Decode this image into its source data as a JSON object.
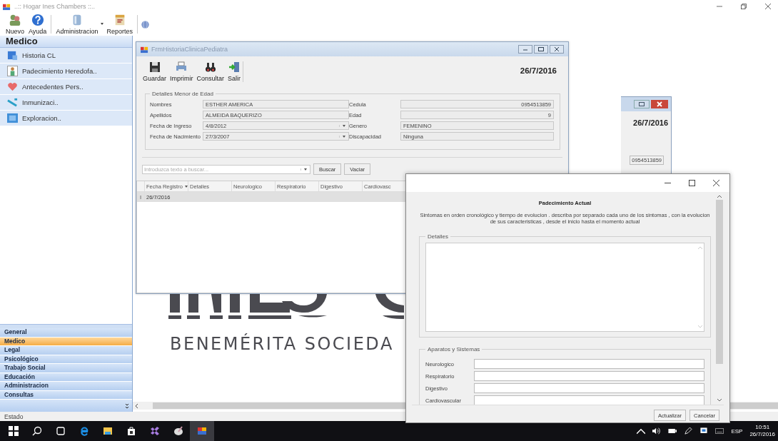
{
  "app": {
    "title": "..:: Hogar Ines Chambers ::.."
  },
  "toolbar": [
    {
      "label": "Nuevo",
      "kind": "people"
    },
    {
      "label": "Ayuda",
      "kind": "help"
    },
    {
      "label": "Administracion",
      "kind": "server"
    },
    {
      "label": "Reportes",
      "kind": "report"
    }
  ],
  "sidebar": {
    "header": "Medico",
    "items": [
      {
        "label": "Historia CL",
        "kind": "folder"
      },
      {
        "label": "Padecimiento Heredofa..",
        "kind": "doctor"
      },
      {
        "label": "Antecedentes Pers..",
        "kind": "heart"
      },
      {
        "label": "Inmunizaci..",
        "kind": "syringe"
      },
      {
        "label": "Exploracion..",
        "kind": "screen"
      }
    ],
    "groups": [
      {
        "label": "General",
        "selected": false
      },
      {
        "label": "Medico",
        "selected": true
      },
      {
        "label": "Legal",
        "selected": false
      },
      {
        "label": "Psicológico",
        "selected": false
      },
      {
        "label": "Trabajo Social",
        "selected": false
      },
      {
        "label": "Educación",
        "selected": false
      },
      {
        "label": "Administracion",
        "selected": false
      },
      {
        "label": "Consultas",
        "selected": false
      }
    ]
  },
  "logo": {
    "subtitle": "BENEMÉRITA SOCIEDA"
  },
  "pediatra_window": {
    "title": "FrmHistoriaClinicaPediatra",
    "toolbar": [
      {
        "label": "Guardar",
        "kind": "save"
      },
      {
        "label": "Imprimir",
        "kind": "print"
      },
      {
        "label": "Consultar",
        "kind": "binoculars"
      },
      {
        "label": "Salir",
        "kind": "exit"
      }
    ],
    "date": "26/7/2016",
    "group_title": "Detalles Menor de Edad",
    "fields": [
      {
        "label": "Nombres",
        "value": "ESTHER AMERICA",
        "kind": "text"
      },
      {
        "label": "Cedula",
        "value": "0954513859",
        "kind": "number"
      },
      {
        "label": "Apellidos",
        "value": "ALMEIDA  BAQUERIZO",
        "kind": "text"
      },
      {
        "label": "Edad",
        "value": "9",
        "kind": "number"
      },
      {
        "label": "Fecha de Ingreso",
        "value": "4/8/2012",
        "kind": "dropdown"
      },
      {
        "label": "Genero",
        "value": "FEMENINO",
        "kind": "text"
      },
      {
        "label": "Fecha de Nacimiento",
        "value": "27/3/2007",
        "kind": "dropdown"
      },
      {
        "label": "Discapacidad",
        "value": "Ninguna",
        "kind": "text"
      }
    ],
    "search": {
      "placeholder": "Introduzca texto a buscar...",
      "buttons": [
        "Buscar",
        "Vaciar"
      ]
    },
    "grid": {
      "columns": [
        {
          "label": "Fecha Registro",
          "sorted": true
        },
        {
          "label": "Detalles",
          "sorted": false
        },
        {
          "label": "Neurologico",
          "sorted": false
        },
        {
          "label": "Respiratorio",
          "sorted": false
        },
        {
          "label": "Digestivo",
          "sorted": false
        },
        {
          "label": "Cardiovasc",
          "sorted": false
        }
      ],
      "rows": [
        {
          "marker": "I",
          "date": "26/7/2016",
          "selected": true
        }
      ]
    }
  },
  "back_window": {
    "date": "26/7/2016",
    "cedula": "0954513859"
  },
  "dialog": {
    "heading": "Padecimiento Actual",
    "description": "Sintomas en orden cronológico y tiempo de evolucion . describa por separado cada uno de los sintomas , con la evolucion de sus caracteristicas , desde el inicio hasta el momento actual",
    "details_title": "Detalles",
    "systems_title": "Aparatos y Sistemas",
    "systems": [
      "Neurologico",
      "Respiratorio",
      "Digestivo",
      "Cardiovascular"
    ],
    "buttons": [
      "Actualizar",
      "Cancelar"
    ]
  },
  "status_bar": "Estado",
  "taskbar": {
    "language": "ESP",
    "time": "10:51",
    "date": "26/7/2016"
  }
}
